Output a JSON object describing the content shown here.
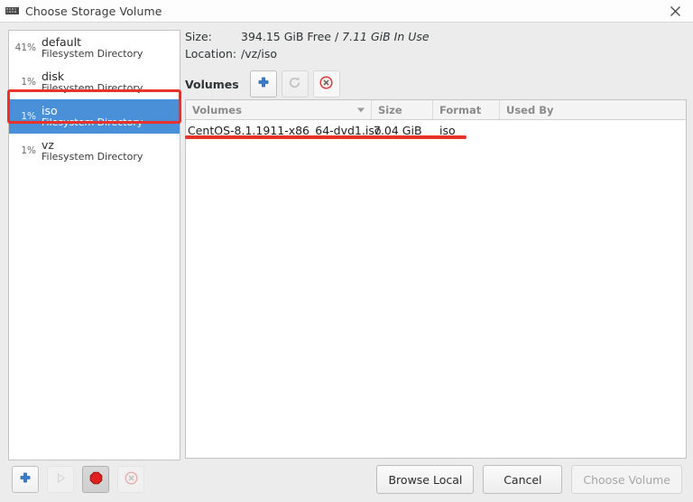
{
  "window": {
    "title": "Choose Storage Volume",
    "icon": "app-icon",
    "close_icon": "close-icon"
  },
  "sidebar": {
    "items": [
      {
        "percent": "41%",
        "name": "default",
        "type": "Filesystem Directory",
        "selected": false
      },
      {
        "percent": "1%",
        "name": "disk",
        "type": "Filesystem Directory",
        "selected": false
      },
      {
        "percent": "1%",
        "name": "iso",
        "type": "Filesystem Directory",
        "selected": true
      },
      {
        "percent": "1%",
        "name": "vz",
        "type": "Filesystem Directory",
        "selected": false
      }
    ],
    "toolbar": [
      {
        "name": "add-pool-button",
        "icon": "plus-icon",
        "state": "enabled"
      },
      {
        "name": "start-pool-button",
        "icon": "play-icon",
        "state": "disabled"
      },
      {
        "name": "stop-pool-button",
        "icon": "stop-icon",
        "state": "enabled"
      },
      {
        "name": "delete-pool-button",
        "icon": "delete-circle-icon",
        "state": "disabled"
      }
    ]
  },
  "details": {
    "size_label": "Size:",
    "size_free": "394.15 GiB Free",
    "size_separator": "/",
    "size_inuse": "7.11 GiB In Use",
    "location_label": "Location:",
    "location_value": "/vz/iso"
  },
  "volumes": {
    "title": "Volumes",
    "toolbar": [
      {
        "name": "add-volume-button",
        "icon": "plus-icon",
        "state": "enabled"
      },
      {
        "name": "refresh-volume-button",
        "icon": "refresh-icon",
        "state": "disabled"
      },
      {
        "name": "delete-volume-button",
        "icon": "delete-circle-icon",
        "state": "enabled"
      }
    ],
    "columns": [
      "Volumes",
      "Size",
      "Format",
      "Used By"
    ],
    "sort_column": "Volumes",
    "rows": [
      {
        "volume": "CentOS-8.1.1911-x86_64-dvd1.iso",
        "size": "7.04 GiB",
        "format": "iso",
        "used_by": ""
      }
    ]
  },
  "footer": {
    "browse_local": "Browse Local",
    "cancel": "Cancel",
    "choose_volume": "Choose Volume",
    "choose_volume_state": "disabled"
  },
  "annotations": {
    "highlight_color": "#e8332a",
    "selection_color": "#4a90d9"
  }
}
